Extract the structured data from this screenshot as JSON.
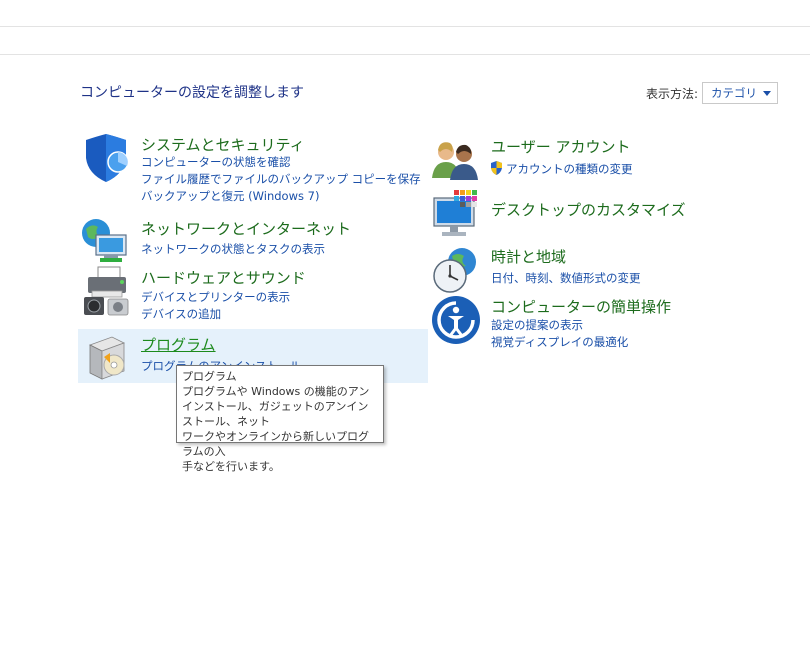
{
  "page_title": "コンピューターの設定を調整します",
  "view_by": {
    "label": "表示方法:",
    "value": "カテゴリ"
  },
  "categories": {
    "system": {
      "title": "システムとセキュリティ",
      "links": [
        "コンピューターの状態を確認",
        "ファイル履歴でファイルのバックアップ コピーを保存",
        "バックアップと復元 (Windows 7)"
      ]
    },
    "network": {
      "title": "ネットワークとインターネット",
      "links": [
        "ネットワークの状態とタスクの表示"
      ]
    },
    "hardware": {
      "title": "ハードウェアとサウンド",
      "links": [
        "デバイスとプリンターの表示",
        "デバイスの追加"
      ]
    },
    "programs": {
      "title": "プログラム",
      "links": [
        "プログラムのアンインストール"
      ]
    },
    "user": {
      "title": "ユーザー アカウント",
      "links": [
        "アカウントの種類の変更"
      ]
    },
    "desktop": {
      "title": "デスクトップのカスタマイズ",
      "links": []
    },
    "clock": {
      "title": "時計と地域",
      "links": [
        "日付、時刻、数値形式の変更"
      ]
    },
    "access": {
      "title": "コンピューターの簡単操作",
      "links": [
        "設定の提案の表示",
        "視覚ディスプレイの最適化"
      ]
    }
  },
  "tooltip": {
    "lines": [
      "プログラム",
      "プログラムや Windows の機能のアンインストール、ガジェットのアンインストール、ネット",
      "ワークやオンラインから新しいプログラムの入",
      "手などを行います。"
    ]
  },
  "colors": {
    "title_green": "#1c6b1c",
    "link_blue": "#1a4fa8",
    "hover_bg": "#e5f1fb",
    "heading_blue": "#1e3287"
  }
}
